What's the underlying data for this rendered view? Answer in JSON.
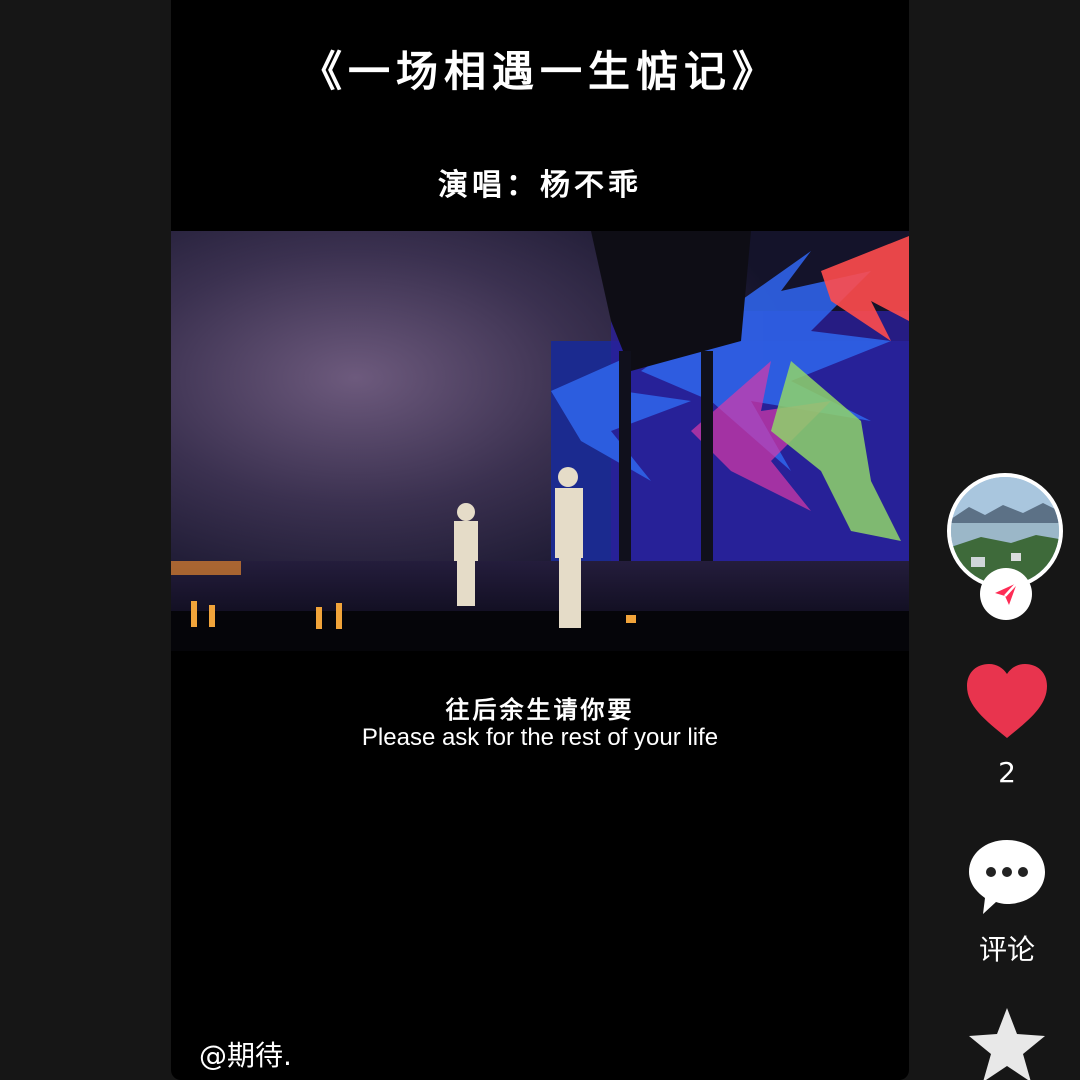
{
  "video": {
    "title": "《一场相遇一生惦记》",
    "singer": "演唱：杨不乖",
    "lyric_cn": "往后余生请你要",
    "lyric_en": "Please ask for the rest of your life",
    "author": "@期待."
  },
  "actions": {
    "like_count": "2",
    "comment_label": "评论",
    "like_color": "#e8344e",
    "follow_color": "#fe2c55"
  }
}
